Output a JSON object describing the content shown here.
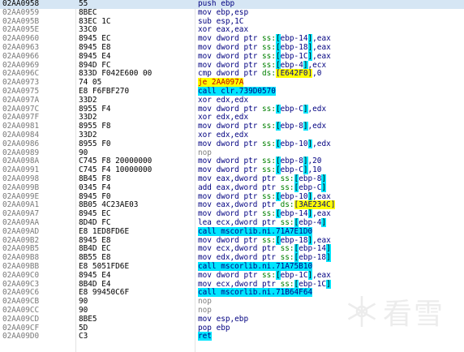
{
  "disassembly": {
    "selected_index": 0,
    "rows": [
      {
        "addr": "02AA0958",
        "bytes": "55",
        "instr": [
          {
            "t": "push ebp"
          }
        ]
      },
      {
        "addr": "02AA0959",
        "bytes": "8BEC",
        "instr": [
          {
            "t": "mov ebp,esp"
          }
        ]
      },
      {
        "addr": "02AA095B",
        "bytes": "83EC 1C",
        "instr": [
          {
            "t": "sub esp,1C"
          }
        ]
      },
      {
        "addr": "02AA095E",
        "bytes": "33C0",
        "instr": [
          {
            "t": "xor eax,eax"
          }
        ]
      },
      {
        "addr": "02AA0960",
        "bytes": "8945 EC",
        "instr": [
          {
            "t": "mov dword ptr "
          },
          {
            "t": "ss:",
            "c": "seg"
          },
          {
            "t": "[",
            "c": "brk"
          },
          {
            "t": "ebp-14"
          },
          {
            "t": "]",
            "c": "brk"
          },
          {
            "t": ",eax"
          }
        ]
      },
      {
        "addr": "02AA0963",
        "bytes": "8945 E8",
        "instr": [
          {
            "t": "mov dword ptr "
          },
          {
            "t": "ss:",
            "c": "seg"
          },
          {
            "t": "[",
            "c": "brk"
          },
          {
            "t": "ebp-18"
          },
          {
            "t": "]",
            "c": "brk"
          },
          {
            "t": ",eax"
          }
        ]
      },
      {
        "addr": "02AA0966",
        "bytes": "8945 E4",
        "instr": [
          {
            "t": "mov dword ptr "
          },
          {
            "t": "ss:",
            "c": "seg"
          },
          {
            "t": "[",
            "c": "brk"
          },
          {
            "t": "ebp-1C"
          },
          {
            "t": "]",
            "c": "brk"
          },
          {
            "t": ",eax"
          }
        ]
      },
      {
        "addr": "02AA0969",
        "bytes": "894D FC",
        "instr": [
          {
            "t": "mov dword ptr "
          },
          {
            "t": "ss:",
            "c": "seg"
          },
          {
            "t": "[",
            "c": "brk"
          },
          {
            "t": "ebp-4"
          },
          {
            "t": "]",
            "c": "brk"
          },
          {
            "t": ",ecx"
          }
        ]
      },
      {
        "addr": "02AA096C",
        "bytes": "833D F042E600 00",
        "instr": [
          {
            "t": "cmp dword ptr "
          },
          {
            "t": "ds:",
            "c": "seg"
          },
          {
            "t": "[E642F0]",
            "c": "hl"
          },
          {
            "t": ",0"
          }
        ]
      },
      {
        "addr": "02AA0973",
        "bytes": "74 05",
        "instr": [
          {
            "t": "je 2AA097A",
            "c": "jmp"
          }
        ]
      },
      {
        "addr": "02AA0975",
        "bytes": "E8 F6FBF270",
        "instr": [
          {
            "t": "call clr.739D0570",
            "c": "call"
          }
        ]
      },
      {
        "addr": "02AA097A",
        "bytes": "33D2",
        "instr": [
          {
            "t": "xor edx,edx"
          }
        ]
      },
      {
        "addr": "02AA097C",
        "bytes": "8955 F4",
        "instr": [
          {
            "t": "mov dword ptr "
          },
          {
            "t": "ss:",
            "c": "seg"
          },
          {
            "t": "[",
            "c": "brk"
          },
          {
            "t": "ebp-C"
          },
          {
            "t": "]",
            "c": "brk"
          },
          {
            "t": ",edx"
          }
        ]
      },
      {
        "addr": "02AA097F",
        "bytes": "33D2",
        "instr": [
          {
            "t": "xor edx,edx"
          }
        ]
      },
      {
        "addr": "02AA0981",
        "bytes": "8955 F8",
        "instr": [
          {
            "t": "mov dword ptr "
          },
          {
            "t": "ss:",
            "c": "seg"
          },
          {
            "t": "[",
            "c": "brk"
          },
          {
            "t": "ebp-8"
          },
          {
            "t": "]",
            "c": "brk"
          },
          {
            "t": ",edx"
          }
        ]
      },
      {
        "addr": "02AA0984",
        "bytes": "33D2",
        "instr": [
          {
            "t": "xor edx,edx"
          }
        ]
      },
      {
        "addr": "02AA0986",
        "bytes": "8955 F0",
        "instr": [
          {
            "t": "mov dword ptr "
          },
          {
            "t": "ss:",
            "c": "seg"
          },
          {
            "t": "[",
            "c": "brk"
          },
          {
            "t": "ebp-10"
          },
          {
            "t": "]",
            "c": "brk"
          },
          {
            "t": ",edx"
          }
        ]
      },
      {
        "addr": "02AA0989",
        "bytes": "90",
        "instr": [
          {
            "t": "nop",
            "c": "nop"
          }
        ]
      },
      {
        "addr": "02AA098A",
        "bytes": "C745 F8 20000000",
        "instr": [
          {
            "t": "mov dword ptr "
          },
          {
            "t": "ss:",
            "c": "seg"
          },
          {
            "t": "[",
            "c": "brk"
          },
          {
            "t": "ebp-8"
          },
          {
            "t": "]",
            "c": "brk"
          },
          {
            "t": ",20"
          }
        ]
      },
      {
        "addr": "02AA0991",
        "bytes": "C745 F4 10000000",
        "instr": [
          {
            "t": "mov dword ptr "
          },
          {
            "t": "ss:",
            "c": "seg"
          },
          {
            "t": "[",
            "c": "brk"
          },
          {
            "t": "ebp-C"
          },
          {
            "t": "]",
            "c": "brk"
          },
          {
            "t": ",10"
          }
        ]
      },
      {
        "addr": "02AA0998",
        "bytes": "8B45 F8",
        "instr": [
          {
            "t": "mov eax,dword ptr "
          },
          {
            "t": "ss:",
            "c": "seg"
          },
          {
            "t": "[",
            "c": "brk"
          },
          {
            "t": "ebp-8"
          },
          {
            "t": "]",
            "c": "brk"
          }
        ]
      },
      {
        "addr": "02AA099B",
        "bytes": "0345 F4",
        "instr": [
          {
            "t": "add eax,dword ptr "
          },
          {
            "t": "ss:",
            "c": "seg"
          },
          {
            "t": "[",
            "c": "brk"
          },
          {
            "t": "ebp-C"
          },
          {
            "t": "]",
            "c": "brk"
          }
        ]
      },
      {
        "addr": "02AA099E",
        "bytes": "8945 F0",
        "instr": [
          {
            "t": "mov dword ptr "
          },
          {
            "t": "ss:",
            "c": "seg"
          },
          {
            "t": "[",
            "c": "brk"
          },
          {
            "t": "ebp-10"
          },
          {
            "t": "]",
            "c": "brk"
          },
          {
            "t": ",eax"
          }
        ]
      },
      {
        "addr": "02AA09A1",
        "bytes": "8B05 4C23AE03",
        "instr": [
          {
            "t": "mov eax,dword ptr "
          },
          {
            "t": "ds:",
            "c": "seg"
          },
          {
            "t": "[3AE234C]",
            "c": "hl"
          }
        ]
      },
      {
        "addr": "02AA09A7",
        "bytes": "8945 EC",
        "instr": [
          {
            "t": "mov dword ptr "
          },
          {
            "t": "ss:",
            "c": "seg"
          },
          {
            "t": "[",
            "c": "brk"
          },
          {
            "t": "ebp-14"
          },
          {
            "t": "]",
            "c": "brk"
          },
          {
            "t": ",eax"
          }
        ]
      },
      {
        "addr": "02AA09AA",
        "bytes": "8D4D FC",
        "instr": [
          {
            "t": "lea ecx,dword ptr "
          },
          {
            "t": "ss:",
            "c": "seg"
          },
          {
            "t": "[",
            "c": "brk"
          },
          {
            "t": "ebp-4"
          },
          {
            "t": "]",
            "c": "brk"
          }
        ]
      },
      {
        "addr": "02AA09AD",
        "bytes": "E8 1ED8FD6E",
        "instr": [
          {
            "t": "call mscorlib.ni.71A7E1D0",
            "c": "call"
          }
        ]
      },
      {
        "addr": "02AA09B2",
        "bytes": "8945 E8",
        "instr": [
          {
            "t": "mov dword ptr "
          },
          {
            "t": "ss:",
            "c": "seg"
          },
          {
            "t": "[",
            "c": "brk"
          },
          {
            "t": "ebp-18"
          },
          {
            "t": "]",
            "c": "brk"
          },
          {
            "t": ",eax"
          }
        ]
      },
      {
        "addr": "02AA09B5",
        "bytes": "8B4D EC",
        "instr": [
          {
            "t": "mov ecx,dword ptr "
          },
          {
            "t": "ss:",
            "c": "seg"
          },
          {
            "t": "[",
            "c": "brk"
          },
          {
            "t": "ebp-14"
          },
          {
            "t": "]",
            "c": "brk"
          }
        ]
      },
      {
        "addr": "02AA09B8",
        "bytes": "8B55 E8",
        "instr": [
          {
            "t": "mov edx,dword ptr "
          },
          {
            "t": "ss:",
            "c": "seg"
          },
          {
            "t": "[",
            "c": "brk"
          },
          {
            "t": "ebp-18"
          },
          {
            "t": "]",
            "c": "brk"
          }
        ]
      },
      {
        "addr": "02AA09BB",
        "bytes": "E8 5051FD6E",
        "instr": [
          {
            "t": "call mscorlib.ni.71A75B10",
            "c": "call"
          }
        ]
      },
      {
        "addr": "02AA09C0",
        "bytes": "8945 E4",
        "instr": [
          {
            "t": "mov dword ptr "
          },
          {
            "t": "ss:",
            "c": "seg"
          },
          {
            "t": "[",
            "c": "brk"
          },
          {
            "t": "ebp-1C"
          },
          {
            "t": "]",
            "c": "brk"
          },
          {
            "t": ",eax"
          }
        ]
      },
      {
        "addr": "02AA09C3",
        "bytes": "8B4D E4",
        "instr": [
          {
            "t": "mov ecx,dword ptr "
          },
          {
            "t": "ss:",
            "c": "seg"
          },
          {
            "t": "[",
            "c": "brk"
          },
          {
            "t": "ebp-1C"
          },
          {
            "t": "]",
            "c": "brk"
          }
        ]
      },
      {
        "addr": "02AA09C6",
        "bytes": "E8 99450C6F",
        "instr": [
          {
            "t": "call mscorlib.ni.71B64F64",
            "c": "call"
          }
        ]
      },
      {
        "addr": "02AA09CB",
        "bytes": "90",
        "instr": [
          {
            "t": "nop",
            "c": "nop"
          }
        ]
      },
      {
        "addr": "02AA09CC",
        "bytes": "90",
        "instr": [
          {
            "t": "nop",
            "c": "nop"
          }
        ]
      },
      {
        "addr": "02AA09CD",
        "bytes": "8BE5",
        "instr": [
          {
            "t": "mov esp,ebp"
          }
        ]
      },
      {
        "addr": "02AA09CF",
        "bytes": "5D",
        "instr": [
          {
            "t": "pop ebp"
          }
        ]
      },
      {
        "addr": "02AA09D0",
        "bytes": "C3",
        "instr": [
          {
            "t": "ret",
            "c": "call"
          }
        ]
      }
    ]
  },
  "watermark": {
    "text": "看雪",
    "icon": "snowflake-logo-icon"
  },
  "colors": {
    "selected_row": "#d6e6f4",
    "instruction_text": "#000080",
    "segment_prefix": "#008000",
    "address_highlight": "#ffff00",
    "call_highlight": "#00e5ff",
    "jump_text": "#c00000"
  }
}
